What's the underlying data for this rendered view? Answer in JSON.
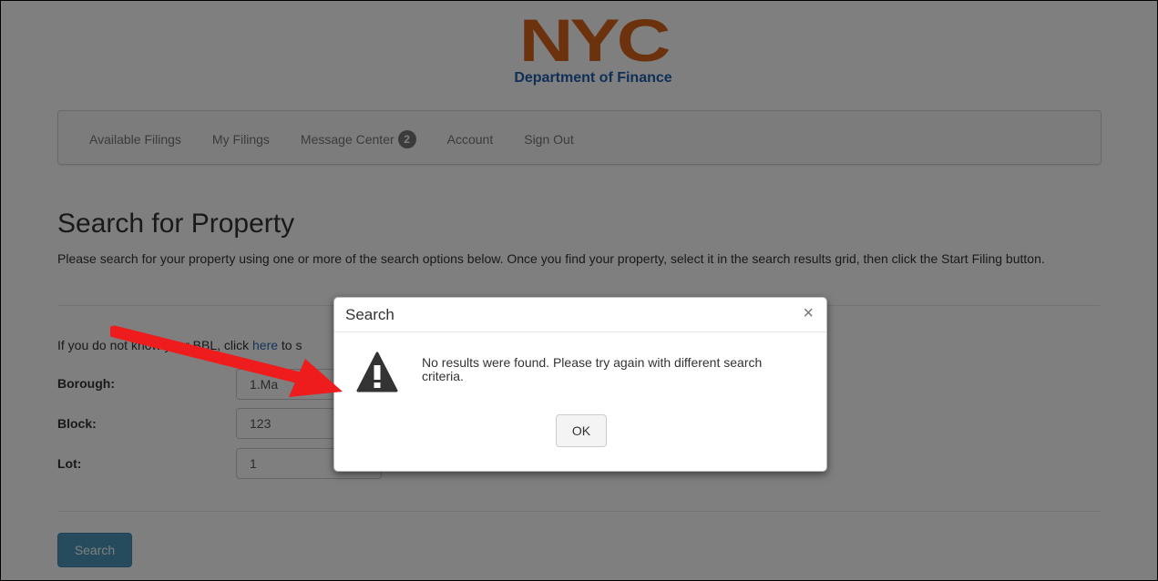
{
  "header": {
    "logo_mark": "NYC",
    "logo_subtitle": "Department of Finance"
  },
  "nav": {
    "items": [
      {
        "label": "Available Filings"
      },
      {
        "label": "My Filings"
      },
      {
        "label": "Message Center",
        "badge": "2"
      },
      {
        "label": "Account"
      },
      {
        "label": "Sign Out"
      }
    ]
  },
  "page": {
    "title": "Search for Property",
    "intro": "Please search for your property using one or more of the search options below. Once you find your property, select it in the search results grid, then click the Start Filing button.",
    "bbl_prefix": "If you do not know your BBL, click ",
    "bbl_link": "here",
    "bbl_suffix": " to s",
    "fields": {
      "borough_label": "Borough:",
      "borough_value": "1.Ma",
      "block_label": "Block:",
      "block_value": "123",
      "lot_label": "Lot:",
      "lot_value": "1"
    },
    "search_button": "Search"
  },
  "modal": {
    "title": "Search",
    "close": "×",
    "message": "No results were found. Please try again with different search criteria.",
    "ok_button": "OK",
    "icon": "warning-icon"
  },
  "colors": {
    "logo_orange": "#d8641c",
    "logo_blue": "#1f5fae",
    "primary_button": "#4b97b8",
    "annotation_arrow": "#ee1c1c"
  }
}
